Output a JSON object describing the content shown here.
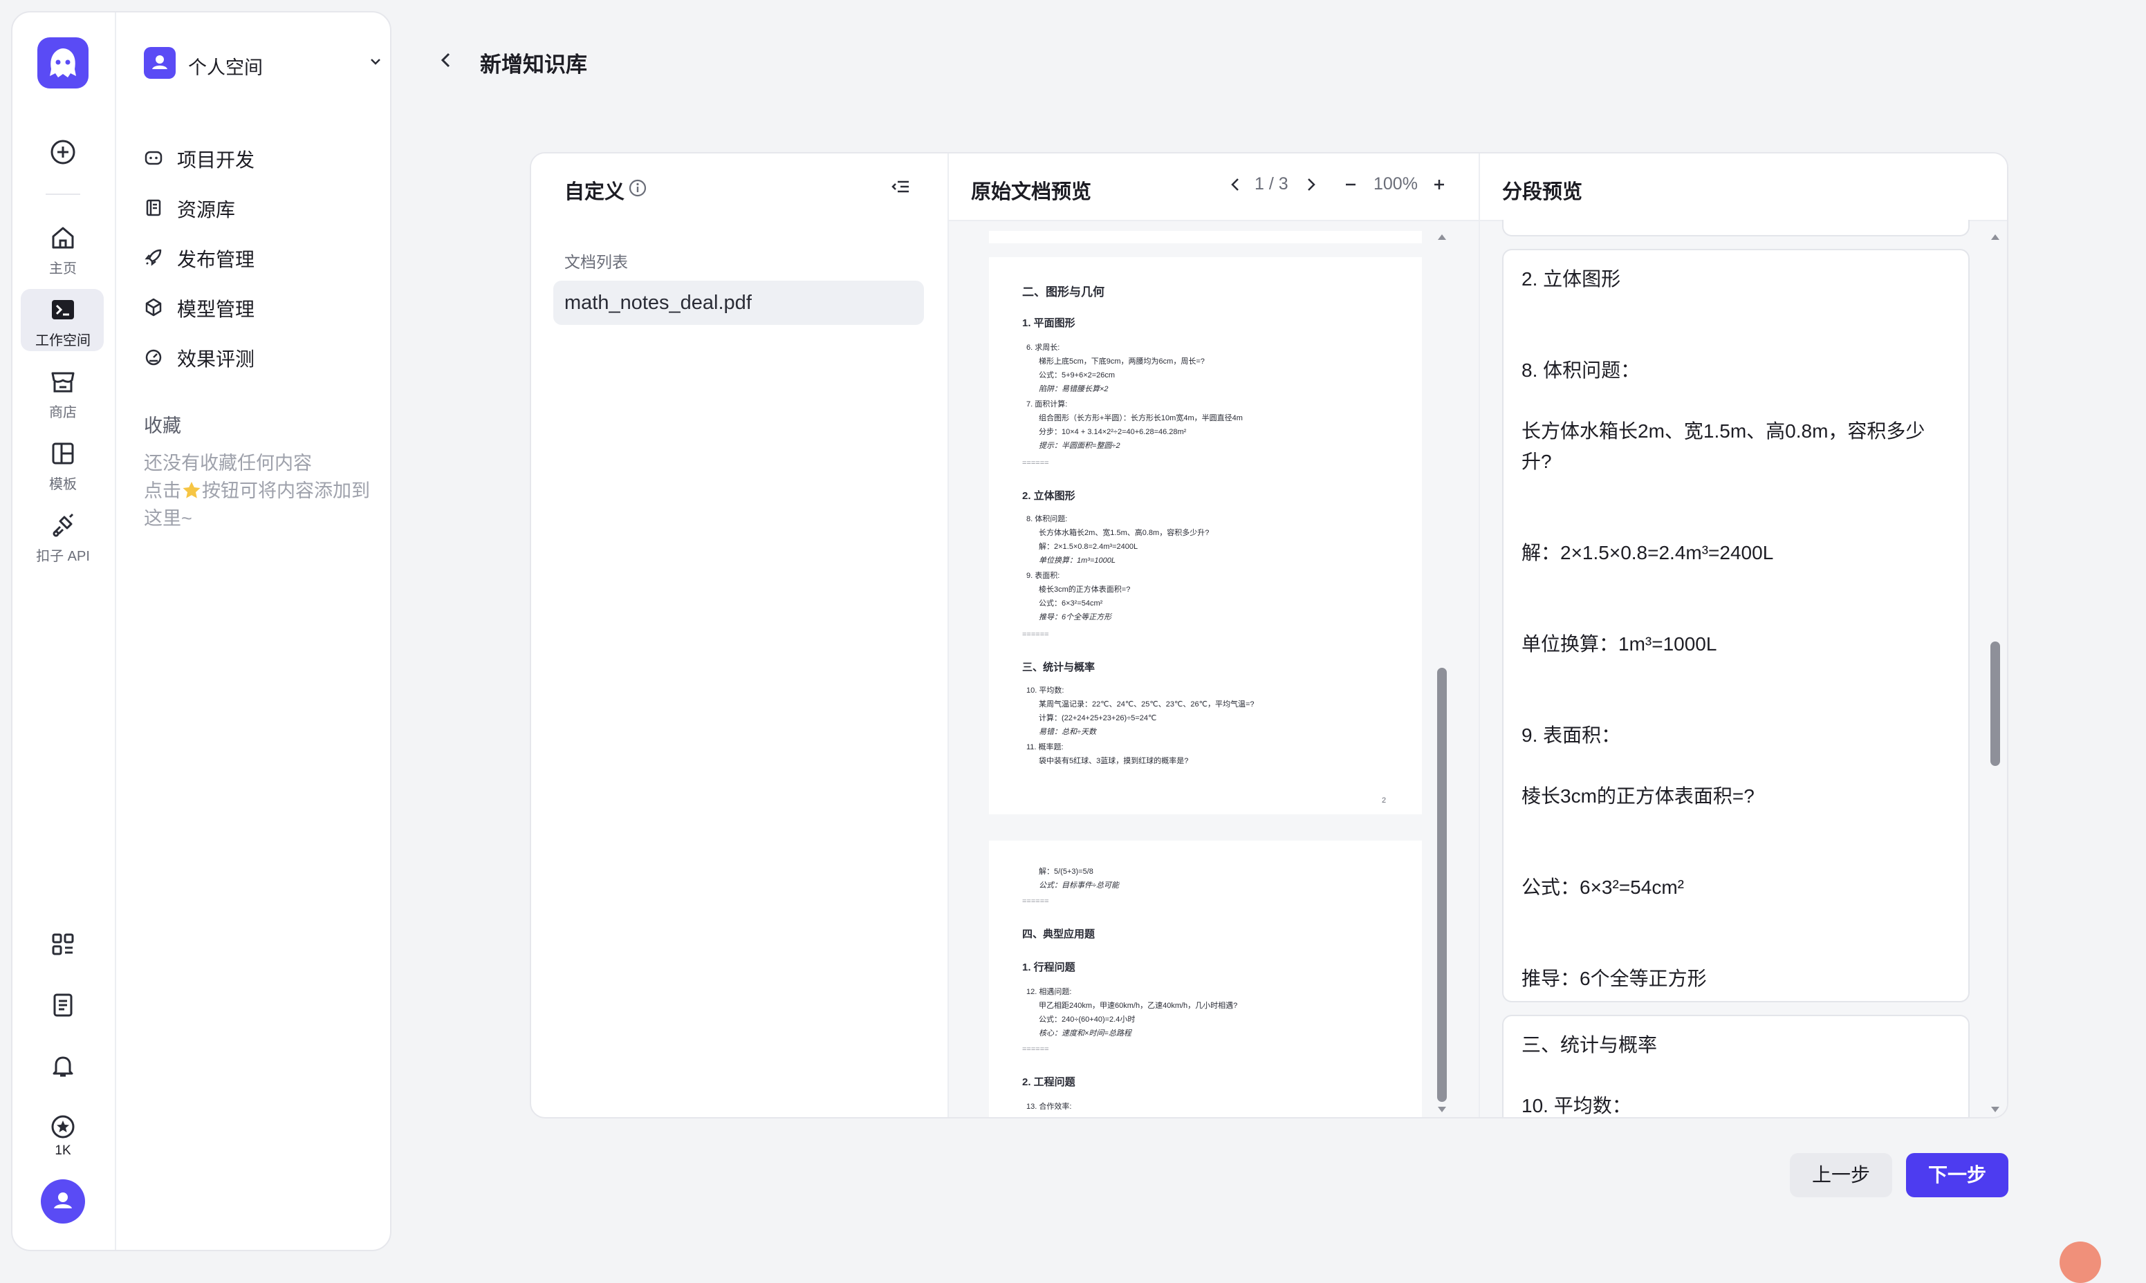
{
  "rail": {
    "items": [
      {
        "label": "主页"
      },
      {
        "label": "工作空间"
      },
      {
        "label": "商店"
      },
      {
        "label": "模板"
      },
      {
        "label": "扣子 API"
      }
    ],
    "credits_label": "1K"
  },
  "sidebar": {
    "space_name": "个人空间",
    "nav": [
      {
        "label": "项目开发"
      },
      {
        "label": "资源库"
      },
      {
        "label": "发布管理"
      },
      {
        "label": "模型管理"
      },
      {
        "label": "效果评测"
      }
    ],
    "favorites_title": "收藏",
    "favorites_empty_line1": "还没有收藏任何内容",
    "favorites_empty_line2_pre": "点击",
    "favorites_empty_line2_post": "按钮可将内容添加到",
    "favorites_empty_line3": "这里~"
  },
  "header": {
    "title": "新增知识库"
  },
  "left_panel": {
    "title": "自定义",
    "doc_list_label": "文档列表",
    "documents": [
      "math_notes_deal.pdf"
    ]
  },
  "preview": {
    "title": "原始文档预览",
    "page_indicator": "1 / 3",
    "zoom": "100%",
    "page2": {
      "lines": [
        "二、图形与几何",
        "1. 平面图形",
        "6. 求周长:",
        "梯形上底5cm，下底9cm，两腰均为6cm，周长=?",
        "公式：5+9+6×2=26cm",
        "陷阱：易错腰长算×2",
        "7. 面积计算:",
        "组合图形（长方形+半圆）：长方形长10m宽4m，半圆直径4m",
        "分步：10×4 + 3.14×2²÷2=40+6.28=46.28m²",
        "提示：半圆面积=整圆÷2",
        "======",
        "2. 立体图形",
        "8. 体积问题:",
        "长方体水箱长2m、宽1.5m、高0.8m，容积多少升?",
        "解：2×1.5×0.8=2.4m³=2400L",
        "单位换算：1m³=1000L",
        "9. 表面积:",
        "棱长3cm的正方体表面积=?",
        "公式：6×3²=54cm²",
        "推导：6个全等正方形",
        "======",
        "三、统计与概率",
        "10. 平均数:",
        "某周气温记录：22℃、24℃、25℃、23℃、26℃，平均气温=?",
        "计算：(22+24+25+23+26)÷5=24℃",
        "易错：总和÷天数",
        "11. 概率题:",
        "袋中装有5红球、3蓝球，摸到红球的概率是?",
        "2"
      ]
    },
    "page3": {
      "lines": [
        "解：5/(5+3)=5/8",
        "公式：目标事件÷总可能",
        "======",
        "四、典型应用题",
        "1. 行程问题",
        "12. 相遇问题:",
        "甲乙相距240km，甲速60km/h，乙速40km/h，几小时相遇?",
        "公式：240÷(60+40)=2.4小时",
        "核心：速度和×时间=总路程",
        "======",
        "2. 工程问题",
        "13. 合作效率:"
      ]
    }
  },
  "segments": {
    "title": "分段预览",
    "card1": [
      "2. 立体图形",
      "8. 体积问题：",
      "长方体水箱长2m、宽1.5m、高0.8m，容积多少",
      "升?",
      "解：2×1.5×0.8=2.4m³=2400L",
      "单位换算：1m³=1000L",
      "9. 表面积：",
      "棱长3cm的正方体表面积=?",
      "公式：6×3²=54cm²",
      "推导：6个全等正方形"
    ],
    "card2": [
      "三、统计与概率",
      "10. 平均数："
    ]
  },
  "footer": {
    "prev_label": "上一步",
    "next_label": "下一步"
  },
  "colors": {
    "accent": "#4d3cf0",
    "brand": "#5a4bf5"
  }
}
